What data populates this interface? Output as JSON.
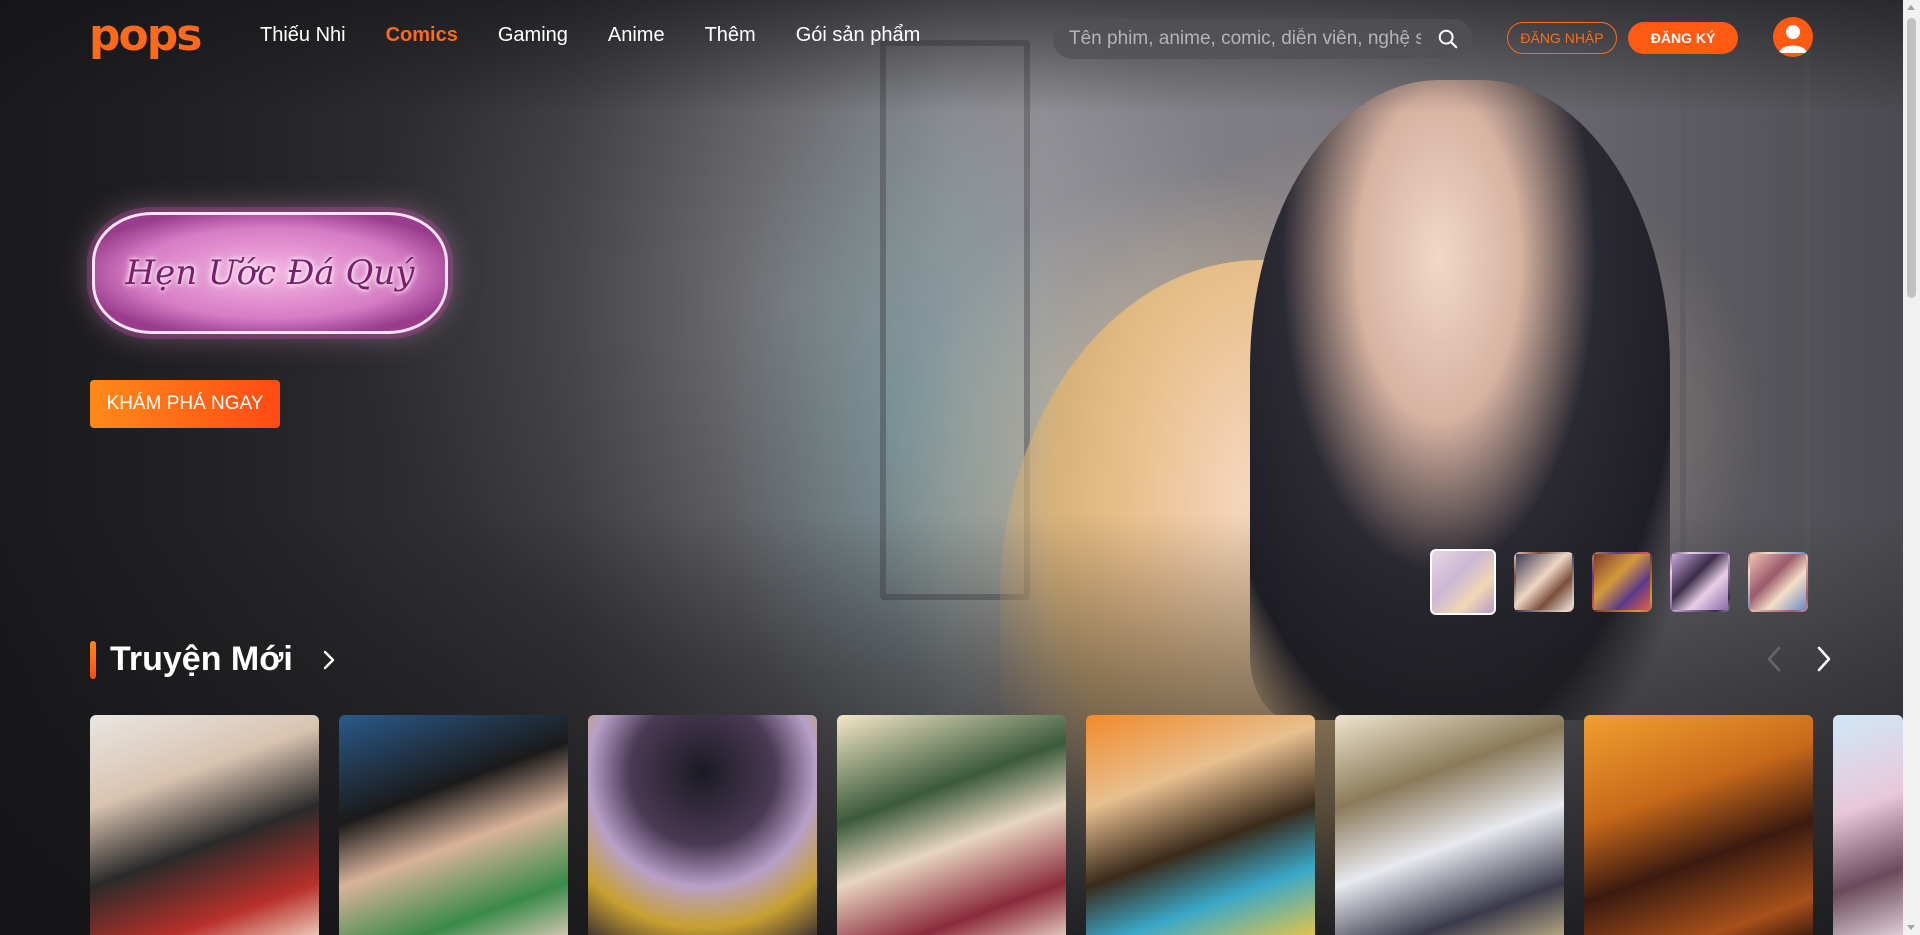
{
  "header": {
    "logo": "pops",
    "nav": [
      {
        "label": "Thiếu Nhi"
      },
      {
        "label": "Comics"
      },
      {
        "label": "Gaming"
      },
      {
        "label": "Anime"
      },
      {
        "label": "Thêm"
      },
      {
        "label": "Gói sản phẩm"
      }
    ],
    "active_nav": "Comics",
    "search": {
      "placeholder": "Tên phim, anime, comic, diễn viên, nghệ sĩ",
      "value": ""
    },
    "login_label": "ĐĂNG NHẬP",
    "register_label": "ĐĂNG KÝ"
  },
  "hero": {
    "title_logo": "Hẹn Ước Đá Quý",
    "cta_label": "KHÁM PHÁ NGAY",
    "thumbnail_count": 5,
    "active_thumbnail": 1
  },
  "section": {
    "title": "Truyện Mới"
  },
  "colors": {
    "accent": "#ff5a14",
    "background": "#1b1b1d"
  },
  "icons": {
    "search": "search-icon",
    "avatar": "user-icon",
    "next": "chevron-right-icon",
    "prev": "chevron-left-icon"
  }
}
